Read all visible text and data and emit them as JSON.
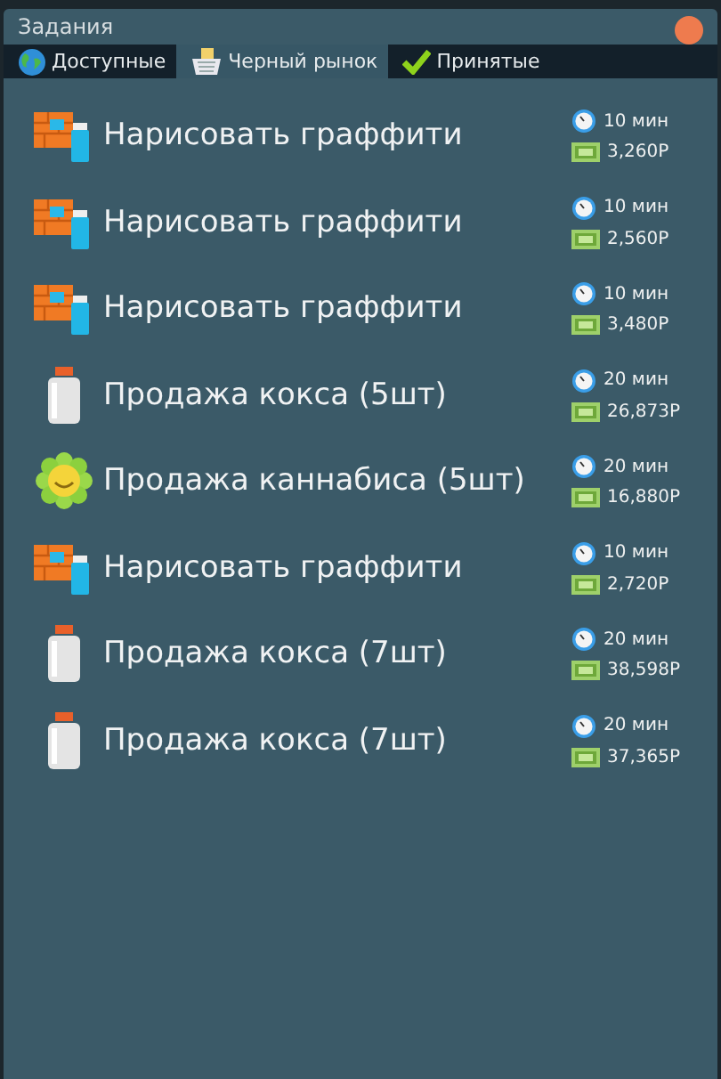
{
  "window": {
    "title": "Задания"
  },
  "tabs": [
    {
      "label": "Доступные",
      "kind": "globe",
      "selected": false
    },
    {
      "label": "Черный рынок",
      "kind": "basket",
      "selected": true
    },
    {
      "label": "Принятые",
      "kind": "check",
      "selected": false
    }
  ],
  "tasks": [
    {
      "kind": "graffiti",
      "title": "Нарисовать граффити",
      "time": "10 мин",
      "reward": "3,260P"
    },
    {
      "kind": "graffiti",
      "title": "Нарисовать граффити",
      "time": "10 мин",
      "reward": "2,560P"
    },
    {
      "kind": "graffiti",
      "title": "Нарисовать граффити",
      "time": "10 мин",
      "reward": "3,480P"
    },
    {
      "kind": "bottle",
      "title": "Продажа кокса (5шт)",
      "time": "20 мин",
      "reward": "26,873P"
    },
    {
      "kind": "flower",
      "title": "Продажа каннабиса (5шт)",
      "time": "20 мин",
      "reward": "16,880P"
    },
    {
      "kind": "graffiti",
      "title": "Нарисовать граффити",
      "time": "10 мин",
      "reward": "2,720P"
    },
    {
      "kind": "bottle",
      "title": "Продажа кокса (7шт)",
      "time": "20 мин",
      "reward": "38,598P"
    },
    {
      "kind": "bottle",
      "title": "Продажа кокса (7шт)",
      "time": "20 мин",
      "reward": "37,365P"
    }
  ]
}
